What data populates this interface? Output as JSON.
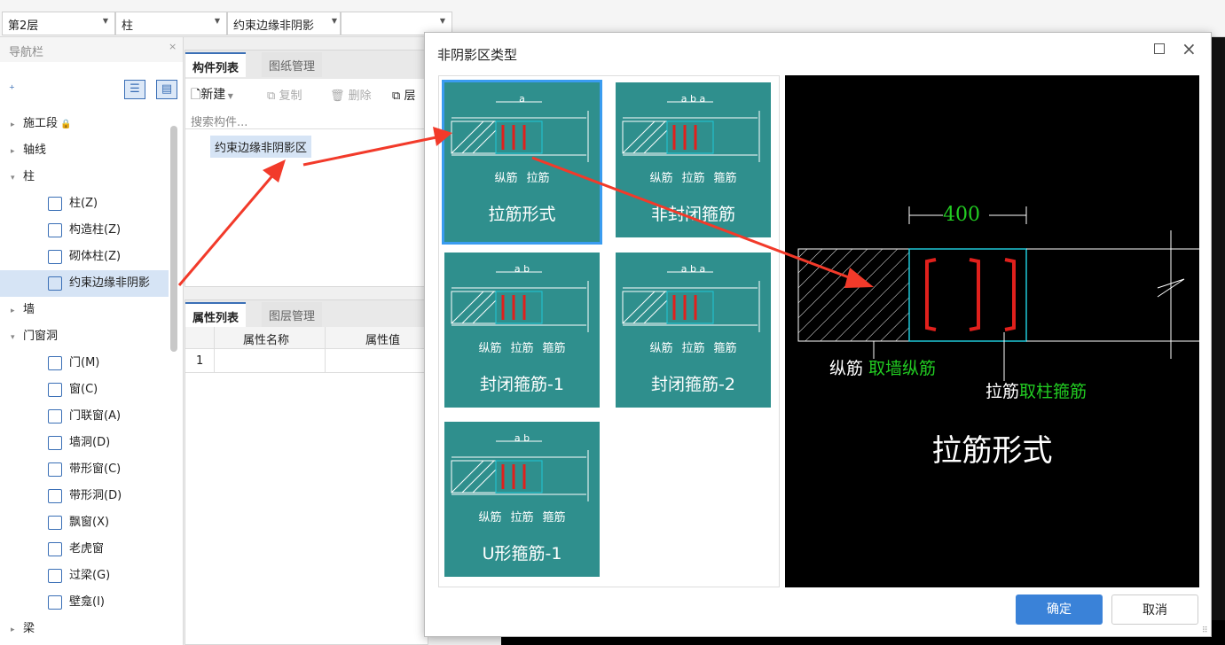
{
  "topbar": {
    "floor": "第2层",
    "type": "柱",
    "component": "约束边缘非阴影",
    "empty": ""
  },
  "nav": {
    "title": "导航栏",
    "items": [
      {
        "label": "施工段",
        "level": 0,
        "tri": "▸"
      },
      {
        "label": "轴线",
        "level": 0,
        "tri": "▸"
      },
      {
        "label": "柱",
        "level": 0,
        "tri": "▾"
      },
      {
        "label": "柱(Z)",
        "level": 1
      },
      {
        "label": "构造柱(Z)",
        "level": 1
      },
      {
        "label": "砌体柱(Z)",
        "level": 1
      },
      {
        "label": "约束边缘非阴影",
        "level": 1,
        "selected": true
      },
      {
        "label": "墙",
        "level": 0,
        "tri": "▸"
      },
      {
        "label": "门窗洞",
        "level": 0,
        "tri": "▾"
      },
      {
        "label": "门(M)",
        "level": 1
      },
      {
        "label": "窗(C)",
        "level": 1
      },
      {
        "label": "门联窗(A)",
        "level": 1
      },
      {
        "label": "墙洞(D)",
        "level": 1
      },
      {
        "label": "带形窗(C)",
        "level": 1
      },
      {
        "label": "带形洞(D)",
        "level": 1
      },
      {
        "label": "飘窗(X)",
        "level": 1
      },
      {
        "label": "老虎窗",
        "level": 1
      },
      {
        "label": "过梁(G)",
        "level": 1
      },
      {
        "label": "壁龛(I)",
        "level": 1
      },
      {
        "label": "梁",
        "level": 0,
        "tri": "▸"
      }
    ]
  },
  "components": {
    "tab_active": "构件列表",
    "tab_inactive": "图纸管理",
    "new_label": "新建",
    "copy_label": "复制",
    "delete_label": "删除",
    "layer_label": "层",
    "search_placeholder": "搜索构件...",
    "item": "约束边缘非阴影区"
  },
  "properties": {
    "tab_active": "属性列表",
    "tab_inactive": "图层管理",
    "col_name": "属性名称",
    "col_value": "属性值",
    "row1": "1"
  },
  "dialog": {
    "title": "非阴影区类型",
    "cards": [
      {
        "label": "拉筋形式",
        "subs": [
          "纵筋",
          "拉筋"
        ],
        "top_dim": "a"
      },
      {
        "label": "非封闭箍筋",
        "subs": [
          "纵筋",
          "拉筋",
          "箍筋"
        ],
        "top_dim": "a b a"
      },
      {
        "label": "封闭箍筋-1",
        "subs": [
          "纵筋",
          "拉筋",
          "箍筋"
        ],
        "top_dim": "a b"
      },
      {
        "label": "封闭箍筋-2",
        "subs": [
          "纵筋",
          "拉筋",
          "箍筋"
        ],
        "top_dim": "a b a"
      },
      {
        "label": "U形箍筋-1",
        "subs": [
          "纵筋",
          "拉筋",
          "箍筋"
        ],
        "top_dim": "a b"
      }
    ],
    "preview": {
      "dim": "400",
      "label1_white": "纵筋 ",
      "label1_green": "取墙纵筋",
      "label2_white": "拉筋",
      "label2_green": "取柱箍筋",
      "title": "拉筋形式"
    },
    "ok": "确定",
    "cancel": "取消"
  },
  "colors": {
    "accent": "#3a82d8",
    "card": "#2f8f8d",
    "rebar": "#e0201c",
    "green_text": "#22cc22",
    "cyan": "#1fc7d8"
  }
}
